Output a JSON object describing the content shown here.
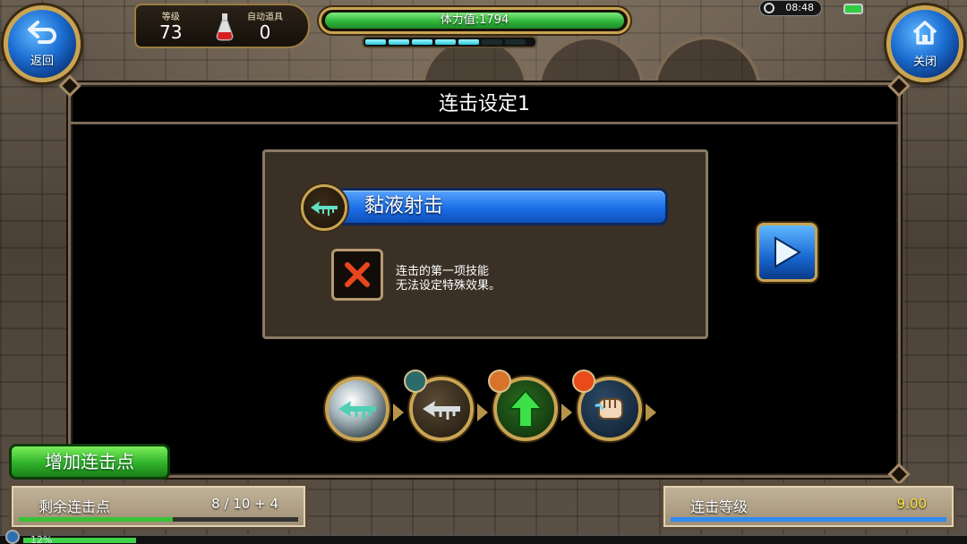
{
  "hud": {
    "back_label": "返回",
    "close_label": "关闭",
    "level_label": "等级",
    "level_value": "73",
    "auto_item_label": "自动道具",
    "auto_item_value": "0",
    "hp_text": "体力值:1794",
    "hp_fraction": 1.0,
    "energy_segments": [
      true,
      true,
      true,
      true,
      true,
      false,
      false
    ],
    "clock": "08:48"
  },
  "dialog": {
    "title": "连击设定1",
    "skill_name": "黏液射击",
    "note_line1": "连击的第一项技能",
    "note_line2": "无法设定特殊效果。"
  },
  "bottom": {
    "add_combo_label": "增加连击点",
    "remaining_label": "剩余连击点",
    "remaining_value": "8 / 10 + 4",
    "remaining_fraction": 0.55,
    "combo_level_label": "连击等级",
    "combo_level_value": "9.00",
    "combo_level_fraction": 1.0,
    "xp_text": "12%",
    "xp_fraction": 0.12
  },
  "colors": {
    "accent_gold": "#c9a452",
    "button_blue": "#1a6ee6",
    "button_green": "#2fb22a"
  },
  "icons": {
    "back": "back-arrow-icon",
    "close": "home-icon",
    "potion": "potion-icon",
    "next": "play-arrow-icon",
    "cancel": "x-icon"
  }
}
